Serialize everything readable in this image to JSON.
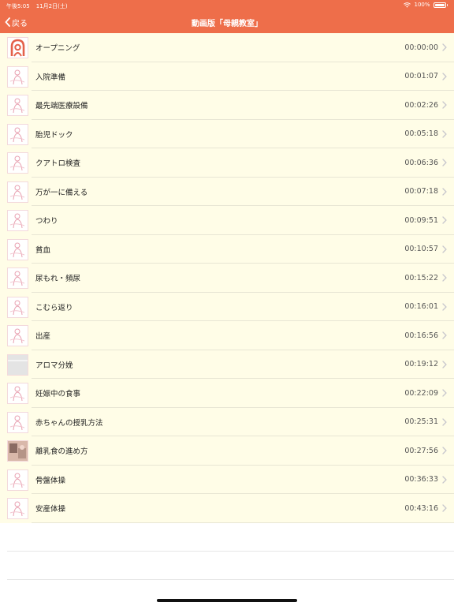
{
  "status": {
    "time": "午後5:05",
    "date": "11月2日(土)",
    "battery": "100%"
  },
  "nav": {
    "back_label": "戻る",
    "title": "動画版「母親教室」"
  },
  "colors": {
    "header": "#ee6e4a",
    "row_bg": "#fffde7"
  },
  "items": [
    {
      "label": "オープニング",
      "time": "00:00:00",
      "thumb": "logo"
    },
    {
      "label": "入院準備",
      "time": "00:01:07",
      "thumb": "sketch"
    },
    {
      "label": "最先端医療設備",
      "time": "00:02:26",
      "thumb": "sketch"
    },
    {
      "label": "胎児ドック",
      "time": "00:05:18",
      "thumb": "sketch"
    },
    {
      "label": "クアトロ検査",
      "time": "00:06:36",
      "thumb": "sketch"
    },
    {
      "label": "万が一に備える",
      "time": "00:07:18",
      "thumb": "sketch"
    },
    {
      "label": "つわり",
      "time": "00:09:51",
      "thumb": "sketch"
    },
    {
      "label": "貧血",
      "time": "00:10:57",
      "thumb": "sketch"
    },
    {
      "label": "尿もれ・頻尿",
      "time": "00:15:22",
      "thumb": "sketch"
    },
    {
      "label": "こむら返り",
      "time": "00:16:01",
      "thumb": "sketch"
    },
    {
      "label": "出産",
      "time": "00:16:56",
      "thumb": "sketch"
    },
    {
      "label": "アロマ分娩",
      "time": "00:19:12",
      "thumb": "gray"
    },
    {
      "label": "妊娠中の食事",
      "time": "00:22:09",
      "thumb": "sketch"
    },
    {
      "label": "赤ちゃんの授乳方法",
      "time": "00:25:31",
      "thumb": "sketch"
    },
    {
      "label": "離乳食の進め方",
      "time": "00:27:56",
      "thumb": "photo"
    },
    {
      "label": "骨盤体操",
      "time": "00:36:33",
      "thumb": "sketch"
    },
    {
      "label": "安産体操",
      "time": "00:43:16",
      "thumb": "sketch"
    }
  ]
}
